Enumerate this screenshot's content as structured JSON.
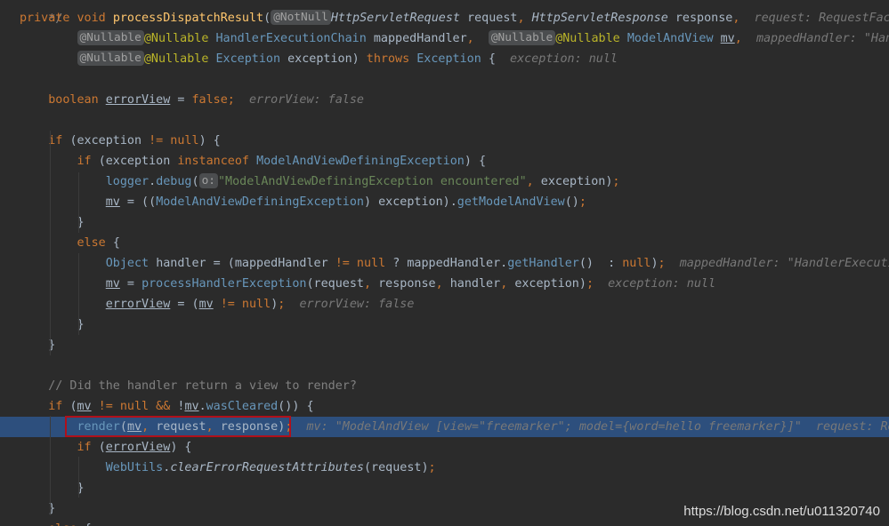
{
  "editor": {
    "top_fragment": "*/",
    "lines": [
      {
        "indent": "",
        "tokens": [
          {
            "c": "k",
            "t": "private "
          },
          {
            "c": "k",
            "t": "void "
          },
          {
            "c": "m",
            "t": "processDispatchResult"
          },
          {
            "c": "t",
            "t": "("
          },
          {
            "c": "bdg",
            "t": "@NotNull"
          },
          {
            "c": "ty it",
            "t": "HttpServletRequest "
          },
          {
            "c": "t",
            "t": "request"
          },
          {
            "c": "k",
            "t": ", "
          },
          {
            "c": "ty it",
            "t": "HttpServletResponse "
          },
          {
            "c": "t",
            "t": "response"
          },
          {
            "c": "k",
            "t": ",  "
          },
          {
            "c": "hint",
            "t": "request: RequestFacade@"
          }
        ]
      },
      {
        "indent": "        ",
        "tokens": [
          {
            "c": "bdg",
            "t": "@Nullable"
          },
          {
            "c": "ann",
            "t": "@Nullable "
          },
          {
            "c": "cls",
            "t": "HandlerExecutionChain "
          },
          {
            "c": "t",
            "t": "mappedHandler"
          },
          {
            "c": "k",
            "t": ",  "
          },
          {
            "c": "bdg",
            "t": "@Nullable"
          },
          {
            "c": "ann",
            "t": "@Nullable "
          },
          {
            "c": "cls",
            "t": "ModelAndView "
          },
          {
            "c": "t u",
            "t": "mv"
          },
          {
            "c": "k",
            "t": ",  "
          },
          {
            "c": "hint",
            "t": "mappedHandler: \"HandlerExecutionChain"
          }
        ]
      },
      {
        "indent": "        ",
        "tokens": [
          {
            "c": "bdg",
            "t": "@Nullable"
          },
          {
            "c": "ann",
            "t": "@Nullable "
          },
          {
            "c": "cls",
            "t": "Exception "
          },
          {
            "c": "t",
            "t": "exception) "
          },
          {
            "c": "k",
            "t": "throws "
          },
          {
            "c": "cls",
            "t": "Exception "
          },
          {
            "c": "t",
            "t": "{  "
          },
          {
            "c": "hint",
            "t": "exception: null"
          }
        ]
      },
      {
        "indent": "",
        "tokens": []
      },
      {
        "indent": "    ",
        "tokens": [
          {
            "c": "k",
            "t": "boolean "
          },
          {
            "c": "t u",
            "t": "errorView"
          },
          {
            "c": "t",
            "t": " = "
          },
          {
            "c": "k",
            "t": "false;  "
          },
          {
            "c": "hint",
            "t": "errorView: false"
          }
        ]
      },
      {
        "indent": "",
        "tokens": []
      },
      {
        "indent": "    ",
        "tokens": [
          {
            "c": "k",
            "t": "if "
          },
          {
            "c": "t",
            "t": "(exception "
          },
          {
            "c": "k",
            "t": "!= null"
          },
          {
            "c": "t",
            "t": ") {"
          }
        ]
      },
      {
        "indent": "        ",
        "tokens": [
          {
            "c": "k",
            "t": "if "
          },
          {
            "c": "t",
            "t": "(exception "
          },
          {
            "c": "k",
            "t": "instanceof "
          },
          {
            "c": "cls",
            "t": "ModelAndViewDefiningException"
          },
          {
            "c": "t",
            "t": ") {"
          }
        ]
      },
      {
        "indent": "            ",
        "tokens": [
          {
            "c": "pm",
            "t": "logger"
          },
          {
            "c": "t",
            "t": "."
          },
          {
            "c": "pm",
            "t": "debug"
          },
          {
            "c": "t",
            "t": "("
          },
          {
            "c": "bdg",
            "t": "o:"
          },
          {
            "c": "s",
            "t": "\"ModelAndViewDefiningException encountered\""
          },
          {
            "c": "k",
            "t": ", "
          },
          {
            "c": "t",
            "t": "exception)"
          },
          {
            "c": "k",
            "t": ";"
          }
        ]
      },
      {
        "indent": "            ",
        "tokens": [
          {
            "c": "t u",
            "t": "mv"
          },
          {
            "c": "t",
            "t": " = (("
          },
          {
            "c": "cls",
            "t": "ModelAndViewDefiningException"
          },
          {
            "c": "t",
            "t": ") exception)."
          },
          {
            "c": "pm",
            "t": "getModelAndView"
          },
          {
            "c": "t",
            "t": "()"
          },
          {
            "c": "k",
            "t": ";"
          }
        ]
      },
      {
        "indent": "        ",
        "tokens": [
          {
            "c": "t",
            "t": "}"
          }
        ]
      },
      {
        "indent": "        ",
        "tokens": [
          {
            "c": "k",
            "t": "else "
          },
          {
            "c": "t",
            "t": "{"
          }
        ]
      },
      {
        "indent": "            ",
        "tokens": [
          {
            "c": "cls",
            "t": "Object "
          },
          {
            "c": "t",
            "t": "handler = (mappedHandler "
          },
          {
            "c": "k",
            "t": "!= null "
          },
          {
            "c": "t",
            "t": "? mappedHandler."
          },
          {
            "c": "pm",
            "t": "getHandler"
          },
          {
            "c": "t",
            "t": "() "
          },
          {
            "c": "t",
            "t": " : "
          },
          {
            "c": "k",
            "t": "null"
          },
          {
            "c": "t",
            "t": ")"
          },
          {
            "c": "k",
            "t": ";  "
          },
          {
            "c": "hint",
            "t": "mappedHandler: \"HandlerExecutionChain"
          }
        ]
      },
      {
        "indent": "            ",
        "tokens": [
          {
            "c": "t u",
            "t": "mv"
          },
          {
            "c": "t",
            "t": " = "
          },
          {
            "c": "pm",
            "t": "processHandlerException"
          },
          {
            "c": "t",
            "t": "(request"
          },
          {
            "c": "k",
            "t": ", "
          },
          {
            "c": "t",
            "t": "response"
          },
          {
            "c": "k",
            "t": ", "
          },
          {
            "c": "t",
            "t": "handler"
          },
          {
            "c": "k",
            "t": ", "
          },
          {
            "c": "t",
            "t": "exception)"
          },
          {
            "c": "k",
            "t": ";  "
          },
          {
            "c": "hint",
            "t": "exception: null"
          }
        ]
      },
      {
        "indent": "            ",
        "tokens": [
          {
            "c": "t u",
            "t": "errorView"
          },
          {
            "c": "t",
            "t": " = ("
          },
          {
            "c": "t u",
            "t": "mv"
          },
          {
            "c": "k",
            "t": " != null"
          },
          {
            "c": "t",
            "t": ")"
          },
          {
            "c": "k",
            "t": ";  "
          },
          {
            "c": "hint",
            "t": "errorView: false"
          }
        ]
      },
      {
        "indent": "        ",
        "tokens": [
          {
            "c": "t",
            "t": "}"
          }
        ]
      },
      {
        "indent": "    ",
        "tokens": [
          {
            "c": "t",
            "t": "}"
          }
        ]
      },
      {
        "indent": "",
        "tokens": []
      },
      {
        "indent": "    ",
        "tokens": [
          {
            "c": "cm",
            "t": "// Did the handler return a view to render?"
          }
        ]
      },
      {
        "indent": "    ",
        "tokens": [
          {
            "c": "k",
            "t": "if "
          },
          {
            "c": "t",
            "t": "("
          },
          {
            "c": "t u",
            "t": "mv"
          },
          {
            "c": "k",
            "t": " != null && "
          },
          {
            "c": "t",
            "t": "!"
          },
          {
            "c": "t u",
            "t": "mv"
          },
          {
            "c": "t",
            "t": "."
          },
          {
            "c": "pm",
            "t": "wasCleared"
          },
          {
            "c": "t",
            "t": "()) {"
          }
        ]
      },
      {
        "indent": "        ",
        "highlight": true,
        "tokens": [
          {
            "c": "pm",
            "t": "render"
          },
          {
            "c": "t",
            "t": "("
          },
          {
            "c": "t u",
            "t": "mv"
          },
          {
            "c": "k",
            "t": ", "
          },
          {
            "c": "t",
            "t": "request"
          },
          {
            "c": "k",
            "t": ", "
          },
          {
            "c": "t",
            "t": "response)"
          },
          {
            "c": "k",
            "t": ";  "
          },
          {
            "c": "hint",
            "t": "mv: \"ModelAndView [view=\"freemarker\"; model={word=hello freemarker}]\"  request: RequestFaca"
          }
        ]
      },
      {
        "indent": "        ",
        "tokens": [
          {
            "c": "k",
            "t": "if "
          },
          {
            "c": "t",
            "t": "("
          },
          {
            "c": "t u",
            "t": "errorView"
          },
          {
            "c": "t",
            "t": ") {"
          }
        ]
      },
      {
        "indent": "            ",
        "tokens": [
          {
            "c": "pm",
            "t": "WebUtils"
          },
          {
            "c": "t",
            "t": "."
          },
          {
            "c": "t it",
            "t": "clearErrorRequestAttributes"
          },
          {
            "c": "t",
            "t": "(request)"
          },
          {
            "c": "k",
            "t": ";"
          }
        ]
      },
      {
        "indent": "        ",
        "tokens": [
          {
            "c": "t",
            "t": "}"
          }
        ]
      },
      {
        "indent": "    ",
        "tokens": [
          {
            "c": "t",
            "t": "}"
          }
        ]
      },
      {
        "indent": "    ",
        "tokens": [
          {
            "c": "k",
            "t": "else "
          },
          {
            "c": "t",
            "t": "{"
          }
        ]
      }
    ]
  },
  "watermark": "https://blog.csdn.net/u011320740",
  "colors": {
    "background": "#2b2b2b",
    "keyword": "#cc7832",
    "method_decl": "#ffc66d",
    "class": "#6897bb",
    "annotation": "#bbb529",
    "string": "#6a8759",
    "comment": "#808080",
    "hint": "#787878",
    "current_line": "#2d4f7d",
    "selection_box": "#b0101a"
  }
}
